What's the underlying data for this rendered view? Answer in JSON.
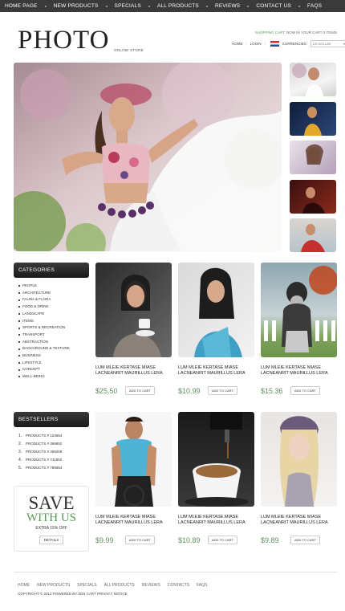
{
  "nav": {
    "items": [
      "Home page",
      "New products",
      "Specials",
      "All products",
      "Reviews",
      "Contact us",
      "FAQs"
    ]
  },
  "logo": {
    "title": "PHOTO",
    "tagline": "ONLINE STORE"
  },
  "cart": {
    "label": "SHOPPING CART:",
    "status": "NOW IN YOUR CART 0 ITEMS"
  },
  "minimenu": {
    "home": "HOME",
    "login": "LOGIN",
    "currencies": "CURRENCIES:",
    "currency_value": "US DOLLAR"
  },
  "categories": {
    "title": "CATEGORIES",
    "items": [
      "People",
      "Architecture",
      "Fauna & Flora",
      "Food & Drink",
      "Landscape",
      "Items",
      "Sports & Recreation",
      "Transport",
      "Abstraction",
      "Background & Texture",
      "Business",
      "Lifestyle",
      "Concept",
      "Well-being"
    ]
  },
  "bestsellers": {
    "title": "BESTSELLERS",
    "items": [
      {
        "num": "1.",
        "label": "PRODUCTS # 123654"
      },
      {
        "num": "2.",
        "label": "PRODUCTS # 369852"
      },
      {
        "num": "3.",
        "label": "PRODUCTS # 369258"
      },
      {
        "num": "4.",
        "label": "PRODUCTS # 741852"
      },
      {
        "num": "5.",
        "label": "PRODUCTS # 789654"
      }
    ]
  },
  "promo": {
    "line1": "SAVE",
    "line2": "WITH US",
    "line3": "EXTRA 15% OFF",
    "button": "DETAILS"
  },
  "products": [
    {
      "name": "LUM MLEIE KERTASE MIASE LACNEANRIT MAURILLUS LERA",
      "price": "$25.50",
      "button": "ADD TO CART",
      "art": "woman-cup"
    },
    {
      "name": "LUM MLEIE KERTASE MIASE LACNEANRIT MAURILLUS LERA",
      "price": "$10.99",
      "button": "ADD TO CART",
      "art": "woman-blue"
    },
    {
      "name": "LUM MLEIE KERTASE MIASE LACNEANRIT MAURILLUS LERA",
      "price": "$15.36",
      "button": "ADD TO CART",
      "art": "dog"
    },
    {
      "name": "LUM MLEIE KERTASE MIASE LACNEANRIT MAURILLUS LERA",
      "price": "$9.99",
      "button": "ADD TO CART",
      "art": "man-bike"
    },
    {
      "name": "LUM MLEIE KERTASE MIASE LACNEANRIT MAURILLUS LERA",
      "price": "$10.89",
      "button": "ADD TO CART",
      "art": "coffee"
    },
    {
      "name": "LUM MLEIE KERTASE MIASE LACNEANRIT MAURILLUS LERA",
      "price": "$9.89",
      "button": "ADD TO CART",
      "art": "woman-scarf"
    }
  ],
  "footer": {
    "links": [
      "Home",
      "New products",
      "Specials",
      "All products",
      "Reviews",
      "Contacts",
      "FAQs"
    ],
    "copyright": "COPYRIGHT © 2012 POWERED BY ZEN CART PRIVACY NOTICE"
  },
  "colors": {
    "accent": "#5f8f5f",
    "dark": "#1f1f1f"
  }
}
